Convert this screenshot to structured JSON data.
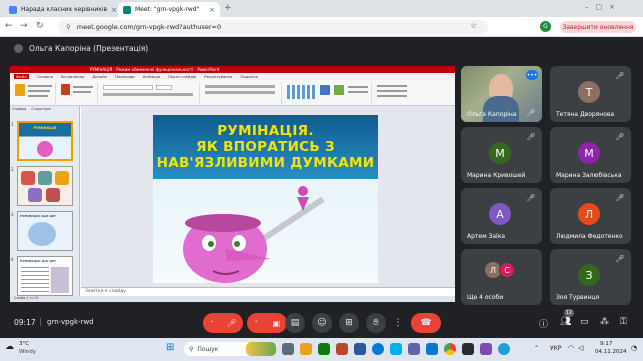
{
  "browser": {
    "tabs": [
      {
        "title": "Нарада класних керівників",
        "active": false,
        "favicon_color": "#4285f4"
      },
      {
        "title": "Meet: \"grn-vpgk-rwd\"",
        "active": true,
        "favicon_color": "#00897b"
      }
    ],
    "new_tab": "+",
    "url": "meet.google.com/grn-vpgk-rwd?authuser=0",
    "profile_initial": "G",
    "update_button": "Завершити оновлення"
  },
  "meet": {
    "presenter_label": "Ольга Капоріна (Презентація)",
    "meeting_time": "09:17",
    "meeting_code": "grn-vpgk-rwd",
    "participant_count": "12",
    "participants": [
      {
        "name": "Ольга Капоріна",
        "initial": "",
        "color": "#7a8a9a",
        "video": true
      },
      {
        "name": "Тетяна Дворянова",
        "initial": "Т",
        "color": "#8d6e63"
      },
      {
        "name": "Марина Кривошей",
        "initial": "М",
        "color": "#33691e"
      },
      {
        "name": "Марина Залюбівська",
        "initial": "М",
        "color": "#8e24aa"
      },
      {
        "name": "Артем Заїка",
        "initial": "А",
        "color": "#7e57c2"
      },
      {
        "name": "Людмила Федотенко",
        "initial": "Л",
        "color": "#e64a19"
      },
      {
        "name": "Ще 4 особи",
        "initial": "Л С",
        "color": "#8d6e63"
      },
      {
        "name": "Зоя Турвинця",
        "initial": "З",
        "color": "#33691e"
      }
    ]
  },
  "powerpoint": {
    "title_text": "РУМІНАЦІЯ - Режим обмеженої функціональності - PowerPoint",
    "tabs": [
      "Файл",
      "Головна",
      "Вставлення",
      "Дизайн",
      "Переходи",
      "Анімація",
      "Показ слайдів",
      "Рецензування",
      "Подання"
    ],
    "notes_placeholder": "Замітки к слайду",
    "status_text": "Слайд 1 із 10",
    "thumb_tabs": [
      "Слайды",
      "Структура"
    ],
    "slide": {
      "line1": "РУМІНАЦІЯ.",
      "line2": "ЯК ВПОРАТИСЬ З",
      "line3": "НАВ'ЯЗЛИВИМИ ДУМКАМИ"
    },
    "thumbnails": [
      {
        "num": "1",
        "label": "РУМІНАЦІЯ"
      },
      {
        "num": "2",
        "label": ""
      },
      {
        "num": "3",
        "label": "РУМІНАЦІЯ: ЩО ЦЕ?"
      },
      {
        "num": "4",
        "label": "РУМІНАЦІЯ: ЩО ЦЕ?"
      }
    ]
  },
  "taskbar": {
    "weather_temp": "3°C",
    "weather_desc": "Windy",
    "search_placeholder": "Пошук",
    "language": "УКР",
    "time": "9:17",
    "date": "04.11.2024"
  }
}
